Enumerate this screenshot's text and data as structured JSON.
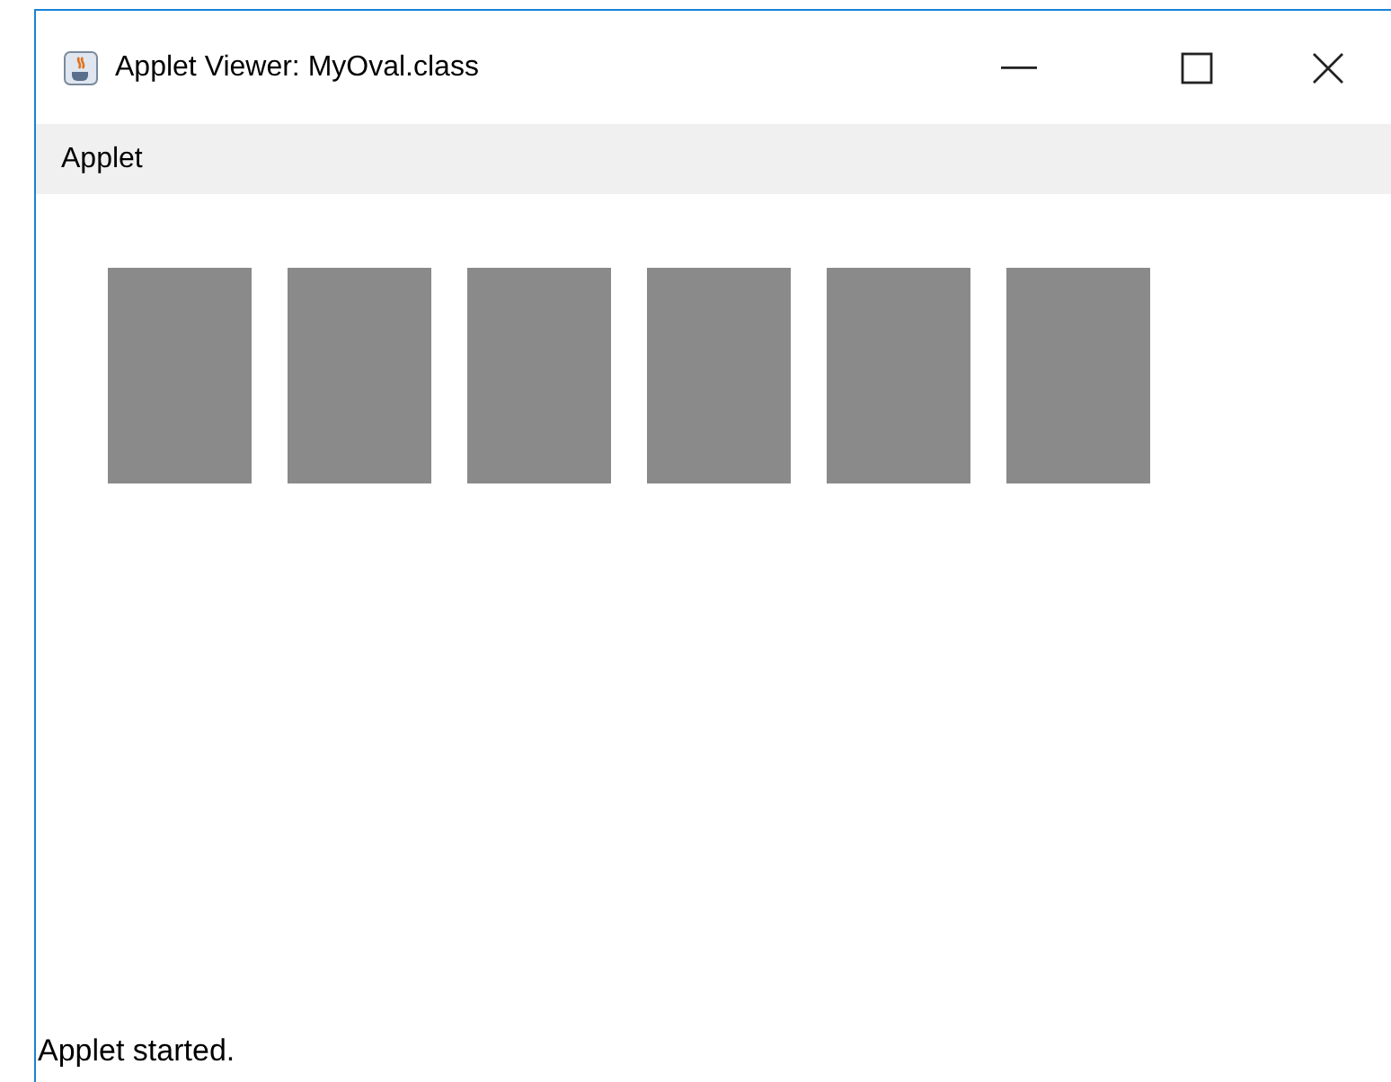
{
  "window": {
    "title": "Applet Viewer: MyOval.class"
  },
  "menu_bar": {
    "items": [
      "Applet"
    ]
  },
  "canvas": {
    "shapes": [
      {
        "kind": "rect"
      },
      {
        "kind": "rect"
      },
      {
        "kind": "rect"
      },
      {
        "kind": "rect"
      },
      {
        "kind": "rect"
      },
      {
        "kind": "rect"
      }
    ]
  },
  "status_bar": {
    "text": "Applet started."
  }
}
